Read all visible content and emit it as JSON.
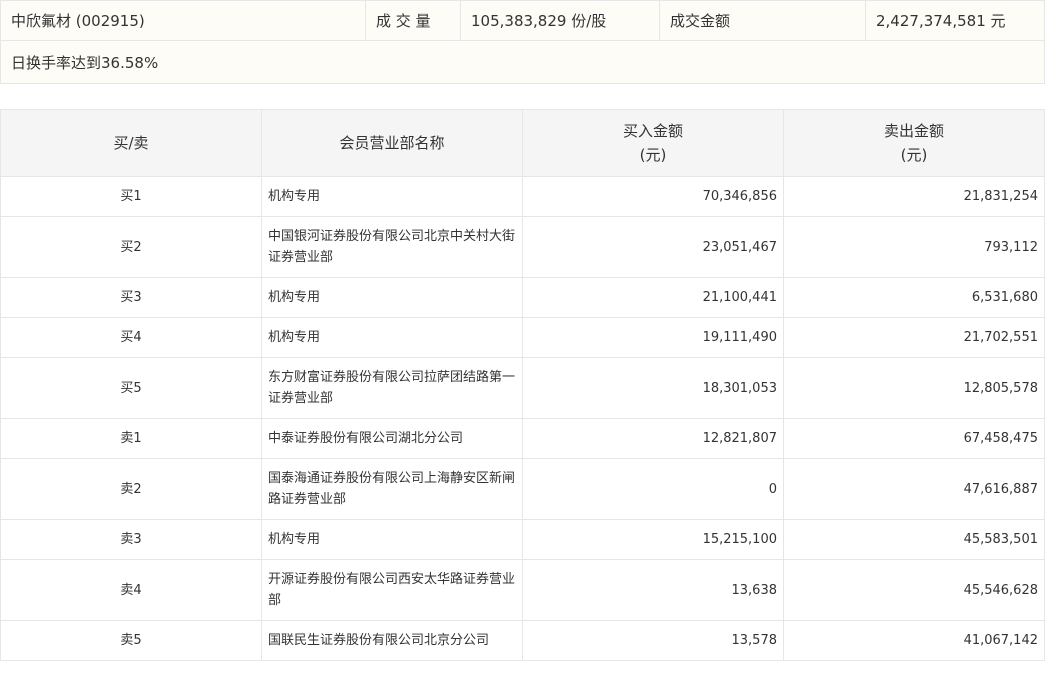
{
  "summary": {
    "stock": "中欣氟材 (002915)",
    "volume_label": "成 交 量",
    "volume_value": "105,383,829 份/股",
    "amount_label": "成交金额",
    "amount_value": "2,427,374,581 元",
    "reason": "日换手率达到36.58%"
  },
  "table": {
    "headers": {
      "side": "买/卖",
      "name": "会员营业部名称",
      "buy_line1": "买入金额",
      "buy_line2": "(元)",
      "sell_line1": "卖出金额",
      "sell_line2": "(元)"
    },
    "rows": [
      {
        "side": "买1",
        "name": "机构专用",
        "buy": "70,346,856",
        "sell": "21,831,254"
      },
      {
        "side": "买2",
        "name": "中国银河证券股份有限公司北京中关村大街证券营业部",
        "buy": "23,051,467",
        "sell": "793,112"
      },
      {
        "side": "买3",
        "name": "机构专用",
        "buy": "21,100,441",
        "sell": "6,531,680"
      },
      {
        "side": "买4",
        "name": "机构专用",
        "buy": "19,111,490",
        "sell": "21,702,551"
      },
      {
        "side": "买5",
        "name": "东方财富证券股份有限公司拉萨团结路第一证券营业部",
        "buy": "18,301,053",
        "sell": "12,805,578"
      },
      {
        "side": "卖1",
        "name": "中泰证券股份有限公司湖北分公司",
        "buy": "12,821,807",
        "sell": "67,458,475"
      },
      {
        "side": "卖2",
        "name": "国泰海通证券股份有限公司上海静安区新闸路证券营业部",
        "buy": "0",
        "sell": "47,616,887"
      },
      {
        "side": "卖3",
        "name": "机构专用",
        "buy": "15,215,100",
        "sell": "45,583,501"
      },
      {
        "side": "卖4",
        "name": "开源证券股份有限公司西安太华路证券营业部",
        "buy": "13,638",
        "sell": "45,546,628"
      },
      {
        "side": "卖5",
        "name": "国联民生证券股份有限公司北京分公司",
        "buy": "13,578",
        "sell": "41,067,142"
      }
    ]
  }
}
